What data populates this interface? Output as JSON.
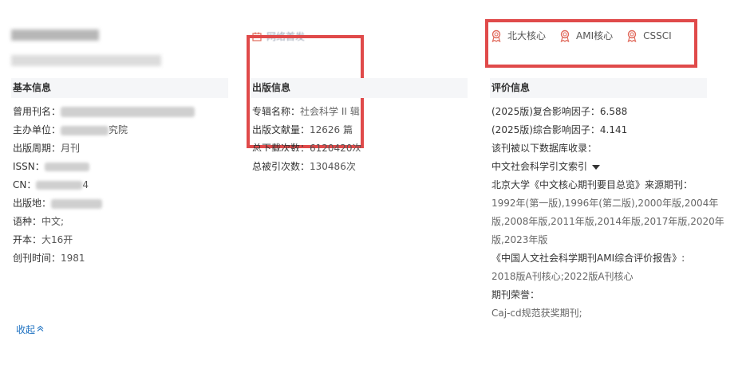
{
  "header": {
    "network_first": "网络首发"
  },
  "badges": [
    {
      "label": "北大核心"
    },
    {
      "label": "AMI核心"
    },
    {
      "label": "CSSCI"
    }
  ],
  "sections": {
    "basic": "基本信息",
    "publication": "出版信息",
    "evaluation": "评价信息"
  },
  "basic": {
    "former_name_label": "曾用刊名：",
    "sponsor_label": "主办单位：",
    "sponsor_value_suffix": "究院",
    "period_label": "出版周期：",
    "period_value": "月刊",
    "issn_label": "ISSN：",
    "cn_label": "CN：",
    "cn_value_suffix": "4",
    "place_label": "出版地：",
    "language_label": "语种：",
    "language_value": "中文;",
    "format_label": "开本：",
    "format_value": "大16开",
    "founded_label": "创刊时间：",
    "founded_value": "1981"
  },
  "publication": {
    "album_label": "专辑名称：",
    "album_value": "社会科学 II 辑",
    "volume_label": "出版文献量：",
    "volume_value": "12626 篇",
    "downloads_label": "总下载次数：",
    "downloads_value": "6120420次",
    "citations_label": "总被引次数：",
    "citations_value": "130486次"
  },
  "evaluation": {
    "composite_if_label": "(2025版)复合影响因子：",
    "composite_if_value": "6.588",
    "comprehensive_if_label": "(2025版)综合影响因子：",
    "comprehensive_if_value": "4.141",
    "db_intro": "该刊被以下数据库收录：",
    "db_select": "中文社会科学引文索引",
    "pku_title": "北京大学《中文核心期刊要目总览》来源期刊：",
    "pku_line1": "1992年(第一版),1996年(第二版),2000年版,2004年",
    "pku_line2": "版,2008年版,2011年版,2014年版,2017年版,2020年",
    "pku_line3": "版,2023年版",
    "ami_title": "《中国人文社会科学期刊AMI综合评价报告》:",
    "ami_value": "2018版A刊核心;2022版A刊核心",
    "honor_title": "期刊荣誉：",
    "honor_value": "Caj-cd规范获奖期刊;"
  },
  "actions": {
    "collapse": "收起",
    "collapse_icon": "double-chevron-up-icon"
  },
  "colors": {
    "accent_red": "#e04a4a",
    "badge_red": "#e0685a",
    "link_blue": "#1a6fc0"
  }
}
